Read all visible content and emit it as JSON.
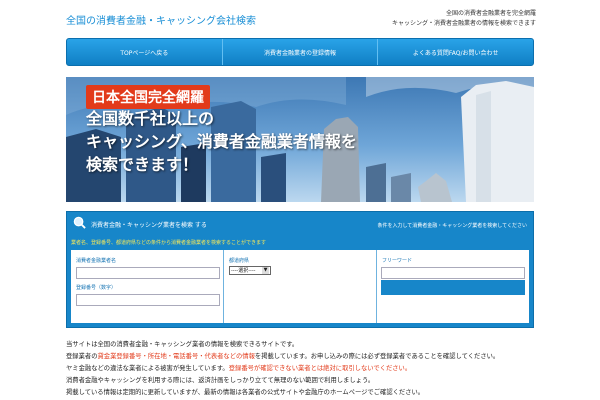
{
  "header": {
    "site_title": "全国の消費者金融・キャッシング会社検索",
    "right_line1": "全国の消費者金融業者を完全網羅",
    "right_line2": "キャッシング・消費者金融業者の情報を検索できます"
  },
  "nav": {
    "items": [
      {
        "label": "TOPページへ戻る"
      },
      {
        "label": "消費者金融業者の登録情報"
      },
      {
        "label": "よくある質問FAQ/お問い合わせ"
      }
    ]
  },
  "hero": {
    "badge": "日本全国完全網羅",
    "line1": "全国数千社以上の",
    "line2": "キャッシング、消費者金融業者情報を",
    "line3": "検索できます！"
  },
  "search": {
    "title": "消費者金融・キャッシング業者を検索 する",
    "note": "条件を入力して消費者金融・キャッシング業者を検索してください",
    "sub": "業者名、登録番号、都道府県などの条件から消費者金融業者を検索することができます",
    "field_name_label": "消費者金融業者名",
    "field_name_value": "",
    "field_reg_label": "登録番号（数字）",
    "field_reg_value": "",
    "pref_label": "都道府県",
    "pref_selected": "----選択----",
    "keyword_label": "フリーワード",
    "keyword_value": "",
    "button_label": ""
  },
  "body": {
    "line1": "当サイトは全国の消費者金融・キャッシング業者の情報を検索できるサイトです。",
    "line2_pre": "登録業者の",
    "line2_red": "貸金業登録番号・所在地・電話番号・代表者などの情報",
    "line2_post": "を掲載しています。お申し込みの際には必ず登録業者であることを確認してください。",
    "line3_pre": "ヤミ金融などの違法な業者による被害が発生しています。",
    "line3_red": "登録番号が確認できない業者とは絶対に取引しないでください。",
    "line4": "消費者金融やキャッシングを利用する際には、返済計画をしっかり立てて無理のない範囲で利用しましょう。",
    "line5": "掲載している情報は定期的に更新していますが、最新の情報は各業者の公式サイトや金融庁のホームページでご確認ください。"
  },
  "colors": {
    "accent": "#1786c9",
    "title": "#1a8fd6",
    "badge": "#e23a1a",
    "sub_text": "#f6e85a"
  },
  "icons": {
    "search": "magnifier-icon",
    "select_arrow": "chevron-down-icon"
  }
}
